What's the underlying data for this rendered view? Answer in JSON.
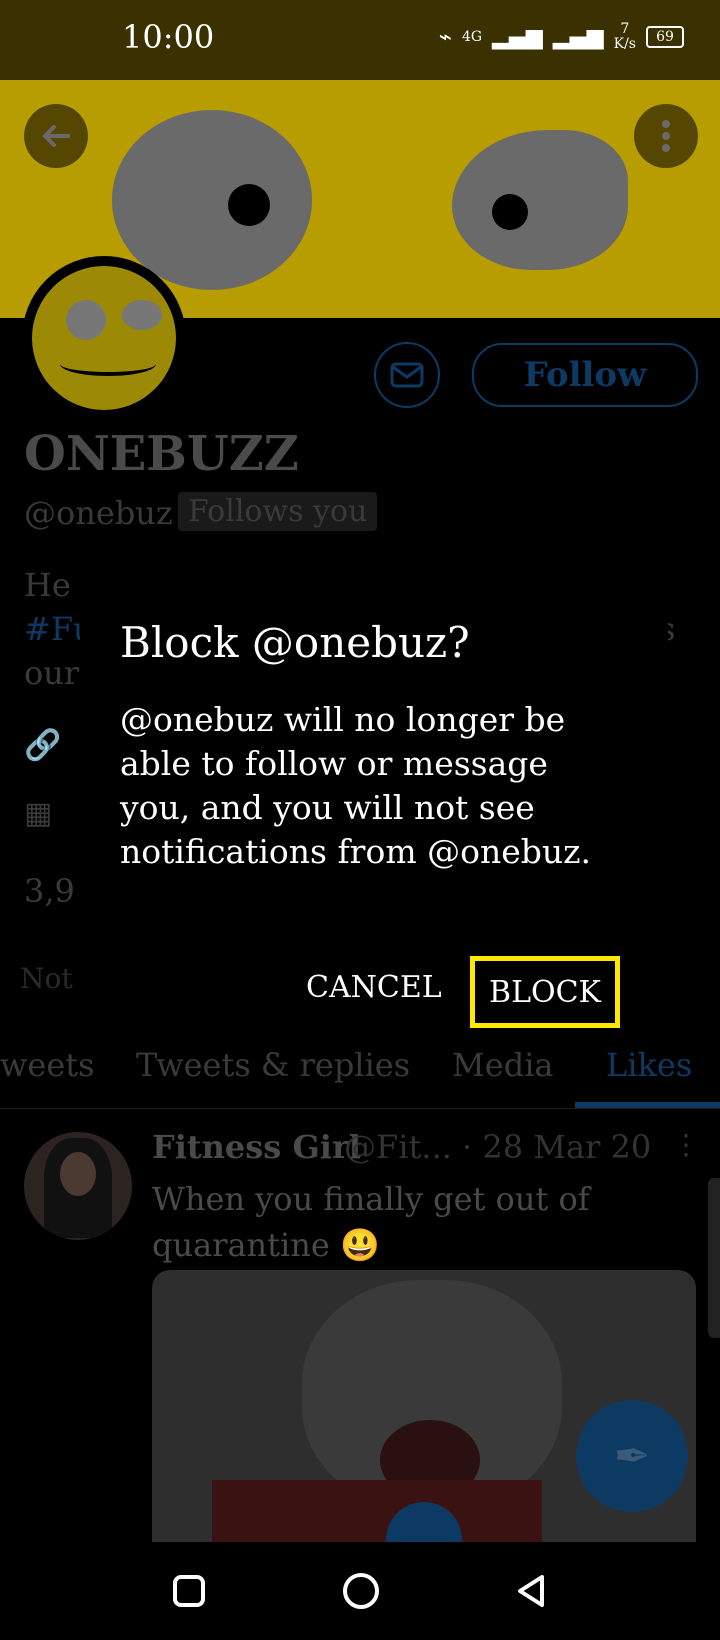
{
  "status_bar": {
    "time": "10:00",
    "network_label": "4G",
    "speed_value": "7",
    "speed_unit": "K/s",
    "battery": "69"
  },
  "profile": {
    "name": "ONEBUZZ",
    "handle": "@onebuz",
    "follows_you_badge": "Follows you",
    "follow_label": "Follow",
    "bio_fragments": [
      "He",
      "#Fu",
      "our",
      "es"
    ],
    "stat_fragment": "3,9",
    "notice_fragment": "Not"
  },
  "tabs": [
    {
      "label": "weets"
    },
    {
      "label": "Tweets & replies"
    },
    {
      "label": "Media"
    },
    {
      "label": "Likes"
    }
  ],
  "tweet": {
    "author_name": "Fitness Girl",
    "author_handle": "@Fit...",
    "date": "· 28 Mar 20",
    "text": "When you finally get out of quarantine 😃"
  },
  "dialog": {
    "title": "Block @onebuz?",
    "body": "@onebuz will no longer be able to follow or message you, and you will not see notifications from @onebuz.",
    "cancel_label": "CANCEL",
    "block_label": "BLOCK"
  },
  "icons": {
    "back": "back-arrow-icon",
    "overflow": "more-vertical-icon",
    "message": "envelope-icon",
    "link": "link-icon",
    "calendar": "calendar-icon",
    "compose": "compose-tweet-icon",
    "nav_recents": "square-icon",
    "nav_home": "circle-icon",
    "nav_back": "triangle-back-icon"
  },
  "colors": {
    "accent_highlight": "#ffe800",
    "twitter_blue_dim": "#0d3a63",
    "status_bar_bg": "#3a3000"
  }
}
